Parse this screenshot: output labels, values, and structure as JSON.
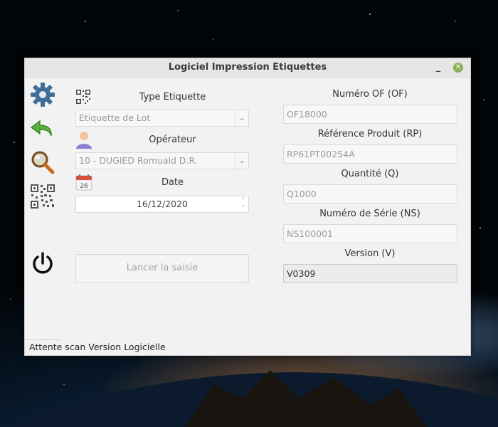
{
  "window": {
    "title": "Logiciel Impression Etiquettes",
    "minimize_glyph": "_",
    "close_glyph": "✕"
  },
  "left_toolbar": {
    "icons": [
      "gear-icon",
      "back-arrow-icon",
      "search-icon",
      "qr-code-icon",
      "power-icon"
    ]
  },
  "form_left": {
    "type_label": "Type Etiquette",
    "type_value": "Etiquette de Lot",
    "operator_label": "Opérateur",
    "operator_value": "10 - DUGIED Romuald D.R.",
    "date_label": "Date",
    "date_value": "16/12/2020",
    "calendar_day": "26",
    "launch_button": "Lancer la saisie"
  },
  "form_right": {
    "of_label": "Numéro OF (OF)",
    "of_value": "OF18000",
    "rp_label": "Référence Produit (RP)",
    "rp_value": "RP61PT00254A",
    "q_label": "Quantité (Q)",
    "q_value": "Q1000",
    "ns_label": "Numéro de Série (NS)",
    "ns_value": "NS100001",
    "v_label": "Version (V)",
    "v_value": "V0309"
  },
  "status": "Attente scan Version Logicielle",
  "colors": {
    "accent_green": "#8bb158",
    "gear_blue": "#3f6f99",
    "back_green": "#58b33a"
  }
}
